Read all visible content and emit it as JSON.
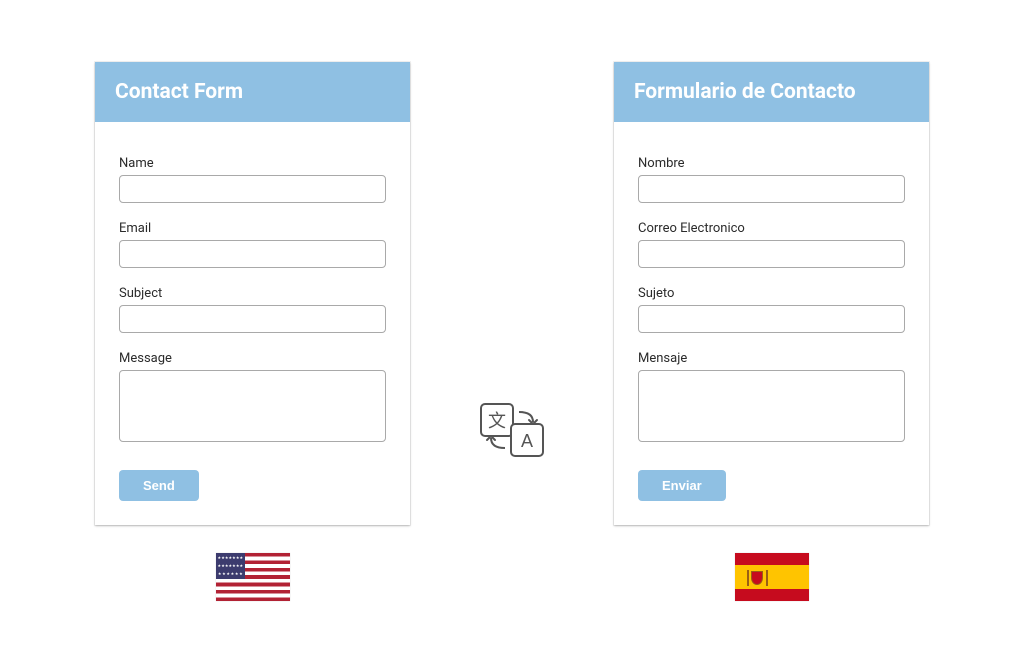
{
  "left": {
    "title": "Contact Form",
    "fields": {
      "name_label": "Name",
      "email_label": "Email",
      "subject_label": "Subject",
      "message_label": "Message"
    },
    "submit_label": "Send",
    "flag": "usa"
  },
  "right": {
    "title": "Formulario de Contacto",
    "fields": {
      "name_label": "Nombre",
      "email_label": "Correo Electronico",
      "subject_label": "Sujeto",
      "message_label": "Mensaje"
    },
    "submit_label": "Enviar",
    "flag": "spain"
  }
}
